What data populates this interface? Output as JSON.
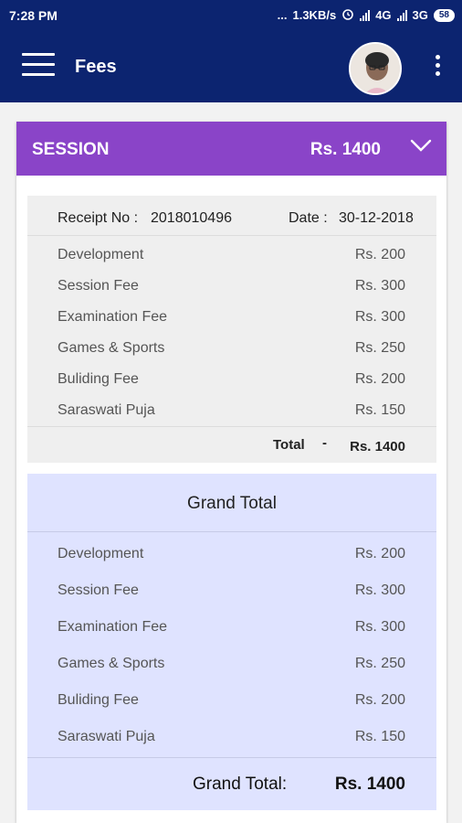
{
  "status_bar": {
    "time": "7:28 PM",
    "dots": "...",
    "speed": "1.3KB/s",
    "network1": "4G",
    "network2": "3G",
    "battery": "58"
  },
  "app_bar": {
    "title": "Fees"
  },
  "session": {
    "label": "SESSION",
    "amount": "Rs. 1400",
    "accent_color": "#8a44c8"
  },
  "receipt": {
    "receipt_label": "Receipt No :",
    "receipt_no": "2018010496",
    "date_label": "Date :",
    "date": "30-12-2018",
    "items": [
      {
        "name": "Development",
        "amount": "Rs. 200"
      },
      {
        "name": "Session Fee",
        "amount": "Rs. 300"
      },
      {
        "name": "Examination Fee",
        "amount": "Rs. 300"
      },
      {
        "name": "Games & Sports",
        "amount": "Rs. 250"
      },
      {
        "name": "Buliding Fee",
        "amount": "Rs. 200"
      },
      {
        "name": "Saraswati Puja",
        "amount": "Rs. 150"
      }
    ],
    "total_label": "Total",
    "total_dash": "-",
    "total_value": "Rs. 1400"
  },
  "grand": {
    "title": "Grand Total",
    "items": [
      {
        "name": "Development",
        "amount": "Rs. 200"
      },
      {
        "name": "Session Fee",
        "amount": "Rs. 300"
      },
      {
        "name": "Examination Fee",
        "amount": "Rs. 300"
      },
      {
        "name": "Games & Sports",
        "amount": "Rs. 250"
      },
      {
        "name": "Buliding Fee",
        "amount": "Rs. 200"
      },
      {
        "name": "Saraswati Puja",
        "amount": "Rs. 150"
      }
    ],
    "total_label": "Grand Total:",
    "total_value": "Rs. 1400"
  },
  "colors": {
    "primary": "#0c2470",
    "session": "#8a44c8",
    "receipt_bg": "#efefef",
    "grand_bg": "#dfe3ff"
  }
}
